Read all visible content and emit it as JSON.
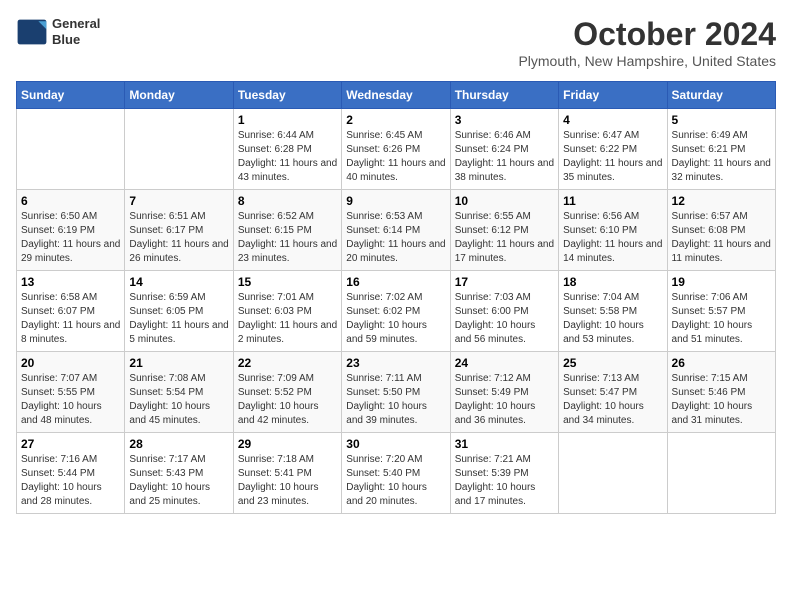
{
  "header": {
    "logo_line1": "General",
    "logo_line2": "Blue",
    "month": "October 2024",
    "location": "Plymouth, New Hampshire, United States"
  },
  "weekdays": [
    "Sunday",
    "Monday",
    "Tuesday",
    "Wednesday",
    "Thursday",
    "Friday",
    "Saturday"
  ],
  "weeks": [
    [
      {
        "day": "",
        "content": ""
      },
      {
        "day": "",
        "content": ""
      },
      {
        "day": "1",
        "content": "Sunrise: 6:44 AM\nSunset: 6:28 PM\nDaylight: 11 hours and 43 minutes."
      },
      {
        "day": "2",
        "content": "Sunrise: 6:45 AM\nSunset: 6:26 PM\nDaylight: 11 hours and 40 minutes."
      },
      {
        "day": "3",
        "content": "Sunrise: 6:46 AM\nSunset: 6:24 PM\nDaylight: 11 hours and 38 minutes."
      },
      {
        "day": "4",
        "content": "Sunrise: 6:47 AM\nSunset: 6:22 PM\nDaylight: 11 hours and 35 minutes."
      },
      {
        "day": "5",
        "content": "Sunrise: 6:49 AM\nSunset: 6:21 PM\nDaylight: 11 hours and 32 minutes."
      }
    ],
    [
      {
        "day": "6",
        "content": "Sunrise: 6:50 AM\nSunset: 6:19 PM\nDaylight: 11 hours and 29 minutes."
      },
      {
        "day": "7",
        "content": "Sunrise: 6:51 AM\nSunset: 6:17 PM\nDaylight: 11 hours and 26 minutes."
      },
      {
        "day": "8",
        "content": "Sunrise: 6:52 AM\nSunset: 6:15 PM\nDaylight: 11 hours and 23 minutes."
      },
      {
        "day": "9",
        "content": "Sunrise: 6:53 AM\nSunset: 6:14 PM\nDaylight: 11 hours and 20 minutes."
      },
      {
        "day": "10",
        "content": "Sunrise: 6:55 AM\nSunset: 6:12 PM\nDaylight: 11 hours and 17 minutes."
      },
      {
        "day": "11",
        "content": "Sunrise: 6:56 AM\nSunset: 6:10 PM\nDaylight: 11 hours and 14 minutes."
      },
      {
        "day": "12",
        "content": "Sunrise: 6:57 AM\nSunset: 6:08 PM\nDaylight: 11 hours and 11 minutes."
      }
    ],
    [
      {
        "day": "13",
        "content": "Sunrise: 6:58 AM\nSunset: 6:07 PM\nDaylight: 11 hours and 8 minutes."
      },
      {
        "day": "14",
        "content": "Sunrise: 6:59 AM\nSunset: 6:05 PM\nDaylight: 11 hours and 5 minutes."
      },
      {
        "day": "15",
        "content": "Sunrise: 7:01 AM\nSunset: 6:03 PM\nDaylight: 11 hours and 2 minutes."
      },
      {
        "day": "16",
        "content": "Sunrise: 7:02 AM\nSunset: 6:02 PM\nDaylight: 10 hours and 59 minutes."
      },
      {
        "day": "17",
        "content": "Sunrise: 7:03 AM\nSunset: 6:00 PM\nDaylight: 10 hours and 56 minutes."
      },
      {
        "day": "18",
        "content": "Sunrise: 7:04 AM\nSunset: 5:58 PM\nDaylight: 10 hours and 53 minutes."
      },
      {
        "day": "19",
        "content": "Sunrise: 7:06 AM\nSunset: 5:57 PM\nDaylight: 10 hours and 51 minutes."
      }
    ],
    [
      {
        "day": "20",
        "content": "Sunrise: 7:07 AM\nSunset: 5:55 PM\nDaylight: 10 hours and 48 minutes."
      },
      {
        "day": "21",
        "content": "Sunrise: 7:08 AM\nSunset: 5:54 PM\nDaylight: 10 hours and 45 minutes."
      },
      {
        "day": "22",
        "content": "Sunrise: 7:09 AM\nSunset: 5:52 PM\nDaylight: 10 hours and 42 minutes."
      },
      {
        "day": "23",
        "content": "Sunrise: 7:11 AM\nSunset: 5:50 PM\nDaylight: 10 hours and 39 minutes."
      },
      {
        "day": "24",
        "content": "Sunrise: 7:12 AM\nSunset: 5:49 PM\nDaylight: 10 hours and 36 minutes."
      },
      {
        "day": "25",
        "content": "Sunrise: 7:13 AM\nSunset: 5:47 PM\nDaylight: 10 hours and 34 minutes."
      },
      {
        "day": "26",
        "content": "Sunrise: 7:15 AM\nSunset: 5:46 PM\nDaylight: 10 hours and 31 minutes."
      }
    ],
    [
      {
        "day": "27",
        "content": "Sunrise: 7:16 AM\nSunset: 5:44 PM\nDaylight: 10 hours and 28 minutes."
      },
      {
        "day": "28",
        "content": "Sunrise: 7:17 AM\nSunset: 5:43 PM\nDaylight: 10 hours and 25 minutes."
      },
      {
        "day": "29",
        "content": "Sunrise: 7:18 AM\nSunset: 5:41 PM\nDaylight: 10 hours and 23 minutes."
      },
      {
        "day": "30",
        "content": "Sunrise: 7:20 AM\nSunset: 5:40 PM\nDaylight: 10 hours and 20 minutes."
      },
      {
        "day": "31",
        "content": "Sunrise: 7:21 AM\nSunset: 5:39 PM\nDaylight: 10 hours and 17 minutes."
      },
      {
        "day": "",
        "content": ""
      },
      {
        "day": "",
        "content": ""
      }
    ]
  ]
}
